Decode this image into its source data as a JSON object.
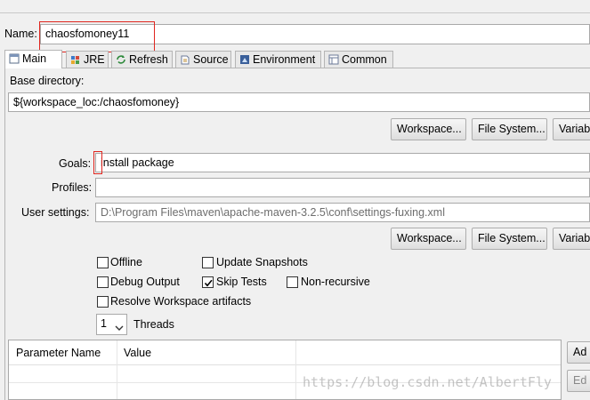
{
  "name": {
    "label": "Name:",
    "value": "chaosfomoney11"
  },
  "tabs": [
    {
      "label": "Main",
      "icon": "main-icon",
      "active": true
    },
    {
      "label": "JRE",
      "icon": "jre-icon"
    },
    {
      "label": "Refresh",
      "icon": "refresh-icon"
    },
    {
      "label": "Source",
      "icon": "source-icon"
    },
    {
      "label": "Environment",
      "icon": "environment-icon"
    },
    {
      "label": "Common",
      "icon": "common-icon"
    }
  ],
  "base_directory": {
    "label": "Base directory:",
    "value": "${workspace_loc:/chaosfomoney}"
  },
  "buttons": {
    "workspace": "Workspace...",
    "file_system": "File System...",
    "variables": "Variab"
  },
  "goals": {
    "label": "Goals:",
    "value": "install package"
  },
  "profiles": {
    "label": "Profiles:",
    "value": ""
  },
  "user_settings": {
    "label": "User settings:",
    "value": "D:\\Program Files\\maven\\apache-maven-3.2.5\\conf\\settings-fuxing.xml"
  },
  "options": {
    "offline": {
      "label": "Offline",
      "checked": false
    },
    "update_snapshots": {
      "label": "Update Snapshots",
      "checked": false
    },
    "debug_output": {
      "label": "Debug Output",
      "checked": false
    },
    "skip_tests": {
      "label": "Skip Tests",
      "checked": true
    },
    "non_recursive": {
      "label": "Non-recursive",
      "checked": false
    },
    "resolve_workspace": {
      "label": "Resolve Workspace artifacts",
      "checked": false
    }
  },
  "threads": {
    "value": "1",
    "label": "Threads"
  },
  "parameters_table": {
    "columns": [
      "Parameter Name",
      "Value"
    ],
    "side_buttons": [
      "Ad",
      "Ed"
    ]
  },
  "watermark": "https://blog.csdn.net/AlbertFly"
}
